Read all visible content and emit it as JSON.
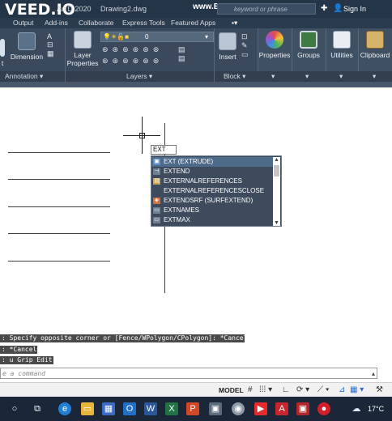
{
  "titlebar": {
    "watermark": "VEED.IO",
    "app_title": "Au    D 2020",
    "file_title": "Drawing2.dwg",
    "bandicam": "www.BANDICAM.com",
    "search_placeholder": "keyword or phrase",
    "signin": "Sign In"
  },
  "tabs": [
    "Output",
    "Add-ins",
    "Collaborate",
    "Express Tools",
    "Featured Apps"
  ],
  "ribbon": {
    "buttons": {
      "text": "t",
      "dimension": "Dimension",
      "layer_properties_1": "Layer",
      "layer_properties_2": "Properties",
      "insert": "Insert",
      "properties": "Properties",
      "groups": "Groups",
      "utilities": "Utilities",
      "clipboard": "Clipboard"
    },
    "layer_value": "0",
    "panel_titles": {
      "annotation": "Annotation",
      "layers": "Layers",
      "block": "Block"
    }
  },
  "canvas": {
    "cmd_input_value": "EXT",
    "autocomplete": [
      {
        "label": "EXT (EXTRUDE)",
        "icon": "extrude-icon",
        "selected": true
      },
      {
        "label": "EXTEND",
        "icon": "extend-icon",
        "selected": false
      },
      {
        "label": "EXTERNALREFERENCES",
        "icon": "xref-icon",
        "selected": false
      },
      {
        "label": "EXTERNALREFERENCESCLOSE",
        "icon": "",
        "selected": false
      },
      {
        "label": "EXTENDSRF (SURFEXTEND)",
        "icon": "surface-extend-icon",
        "selected": false
      },
      {
        "label": "EXTNAMES",
        "icon": "command-icon",
        "selected": false
      },
      {
        "label": "EXTMAX",
        "icon": "command-icon",
        "selected": false
      }
    ]
  },
  "command_history": [
    ": Specify opposite corner or [Fence/WPolygon/CPolygon]: *Cancel*",
    ": *Cancel*",
    ": u Grip Edit"
  ],
  "command_line_placeholder": "e a command",
  "statusbar": {
    "model": "MODEL"
  },
  "taskbar": {
    "temperature": "17°C"
  },
  "colors": {
    "titlebar": "#253548",
    "ribbon": "#3a4a5c",
    "autocomplete_bg": "#3d4b5c",
    "autocomplete_selected": "#4e6a8a",
    "taskbar": "#1b2638"
  }
}
